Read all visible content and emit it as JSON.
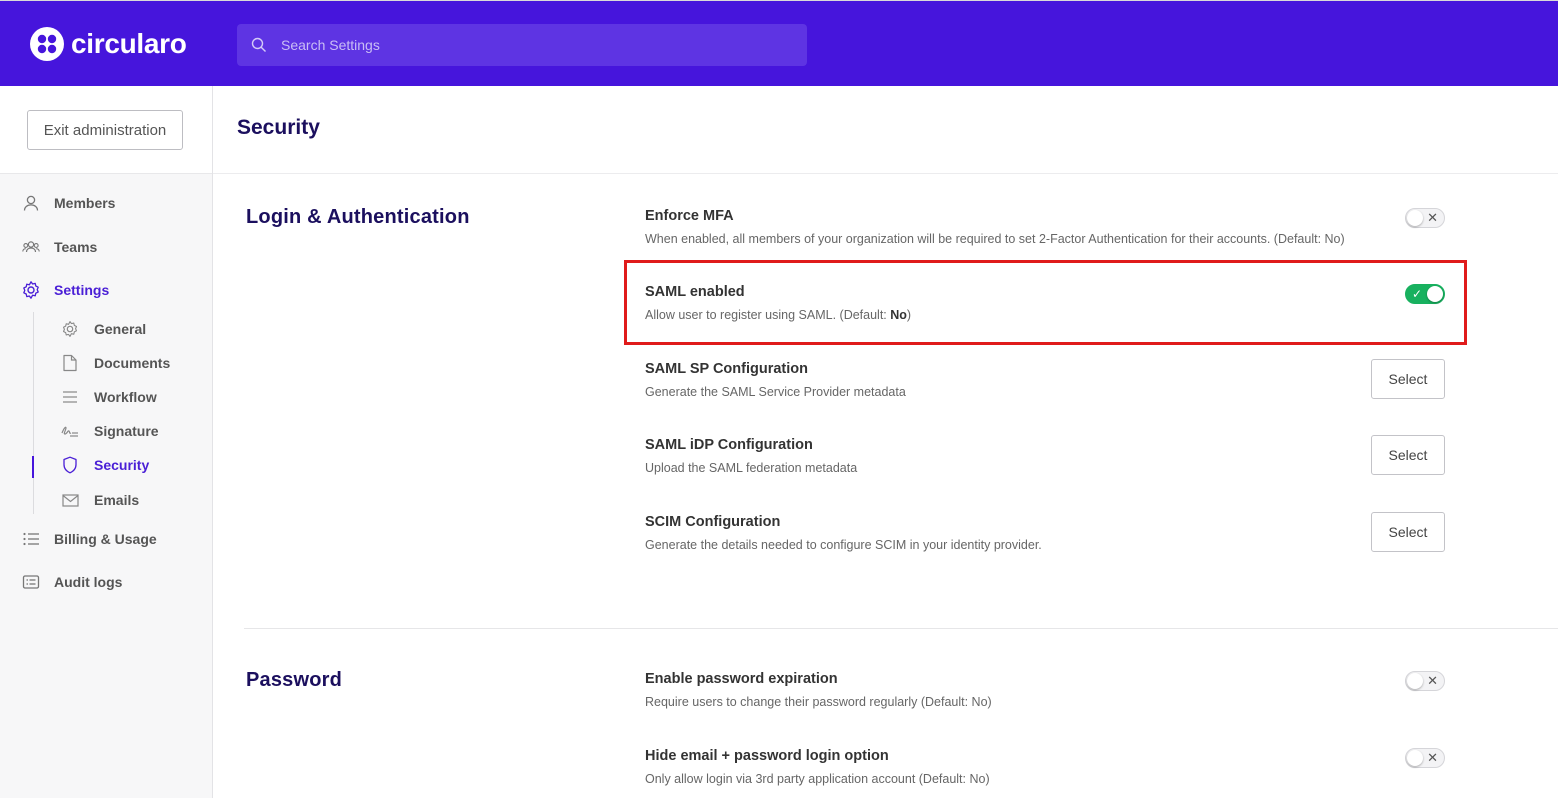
{
  "app": {
    "name": "circularo"
  },
  "search": {
    "placeholder": "Search Settings"
  },
  "sidebar": {
    "exit_label": "Exit administration",
    "items": [
      {
        "label": "Members",
        "icon": "user-icon"
      },
      {
        "label": "Teams",
        "icon": "users-icon"
      },
      {
        "label": "Settings",
        "icon": "gear-icon",
        "active": true
      },
      {
        "label": "Billing & Usage",
        "icon": "list-icon"
      },
      {
        "label": "Audit logs",
        "icon": "log-icon"
      }
    ],
    "sub_items": [
      {
        "label": "General",
        "icon": "gear-icon"
      },
      {
        "label": "Documents",
        "icon": "document-icon"
      },
      {
        "label": "Workflow",
        "icon": "lines-icon"
      },
      {
        "label": "Signature",
        "icon": "signature-icon"
      },
      {
        "label": "Security",
        "icon": "shield-icon",
        "active": true
      },
      {
        "label": "Emails",
        "icon": "envelope-icon"
      }
    ]
  },
  "page": {
    "title": "Security"
  },
  "sections": [
    {
      "title": "Login & Authentication",
      "settings": [
        {
          "label": "Enforce MFA",
          "desc": "When enabled, all members of your organization will be required to set 2-Factor Authentication for their accounts.  (Default: No)",
          "control": "toggle",
          "value": false
        },
        {
          "label": "SAML enabled",
          "desc_prefix": "Allow user to register using SAML.  (Default: ",
          "desc_bold": "No",
          "desc_suffix": ")",
          "control": "toggle",
          "value": true
        },
        {
          "label": "SAML SP Configuration",
          "desc": "Generate the SAML Service Provider metadata",
          "control": "button",
          "button_label": "Select"
        },
        {
          "label": "SAML iDP Configuration",
          "desc": "Upload the SAML federation metadata",
          "control": "button",
          "button_label": "Select"
        },
        {
          "label": "SCIM Configuration",
          "desc": "Generate the details needed to configure SCIM in your identity provider.",
          "control": "button",
          "button_label": "Select"
        }
      ]
    },
    {
      "title": "Password",
      "settings": [
        {
          "label": "Enable password expiration",
          "desc": "Require users to change their password regularly  (Default: No)",
          "control": "toggle",
          "value": false
        },
        {
          "label": "Hide email + password login option",
          "desc": "Only allow login via 3rd party application account  (Default: No)",
          "control": "toggle",
          "value": false
        }
      ]
    }
  ],
  "colors": {
    "brand": "#4615dc",
    "toggle_on": "#18b15f",
    "highlight": "#e01b1b",
    "heading": "#1b0f5e"
  },
  "toggle_marks": {
    "on": "✓",
    "off": "✕"
  }
}
